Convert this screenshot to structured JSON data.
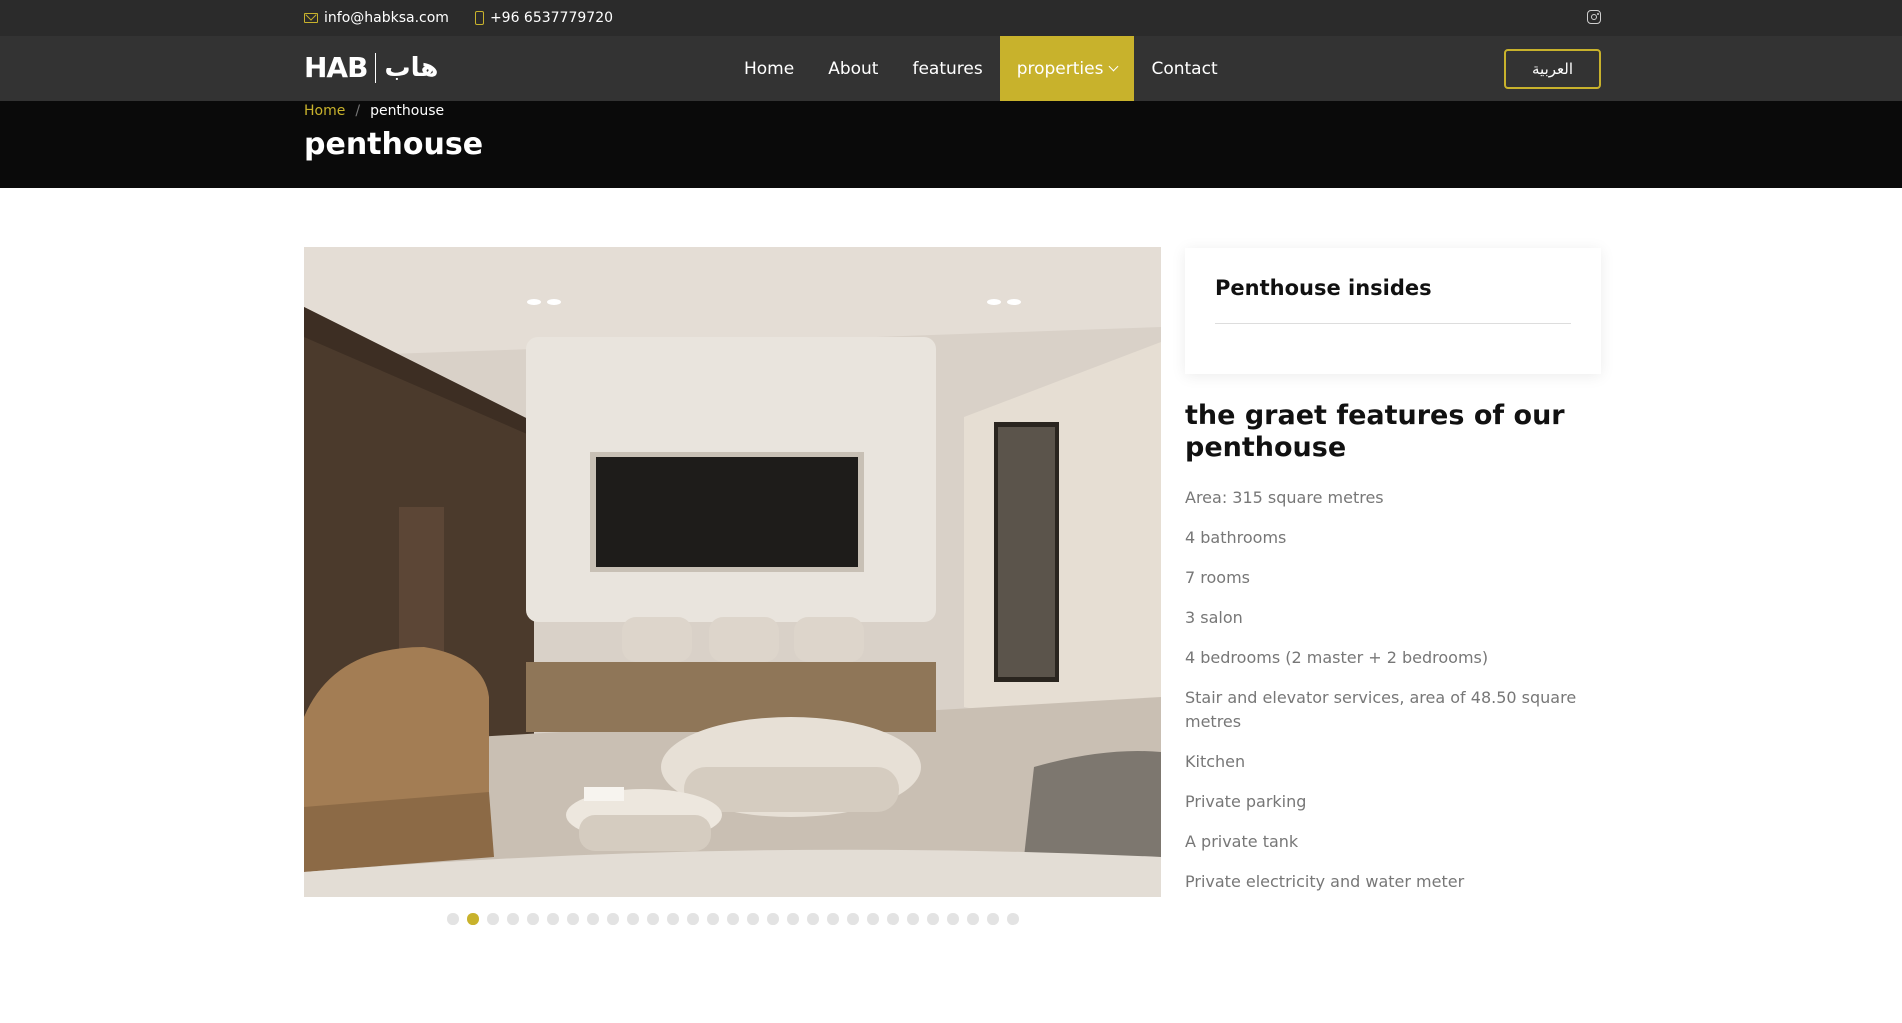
{
  "topbar": {
    "email": "info@habksa.com",
    "phone": "+96 6537779720",
    "icons": [
      "mail-icon",
      "phone-icon",
      "instagram-icon"
    ]
  },
  "logo": {
    "latin": "HAB",
    "arabic": "هاب"
  },
  "nav": {
    "items": [
      {
        "label": "Home"
      },
      {
        "label": "About"
      },
      {
        "label": "features"
      },
      {
        "label": "properties",
        "active": true,
        "dropdown": true
      },
      {
        "label": "Contact"
      }
    ],
    "language_button": "العربية"
  },
  "breadcrumb": {
    "home": "Home",
    "separator": "/",
    "current": "penthouse"
  },
  "page_title": "penthouse",
  "gallery": {
    "slide_count": 29,
    "active_index": 1
  },
  "sidebar": {
    "card_title": "Penthouse insides",
    "features_title": "the graet features of our penthouse",
    "features": [
      "Area: 315 square metres",
      "4 bathrooms",
      "7 rooms",
      "3 salon",
      "4 bedrooms (2 master + 2 bedrooms)",
      "Stair and elevator services, area of 48.50 square metres",
      "Kitchen",
      "Private parking",
      "A private tank",
      "Private electricity and water meter"
    ]
  },
  "colors": {
    "accent": "#c8b22c",
    "topbar_bg": "#2b2b2b",
    "navbar_bg": "#333333",
    "header_bg": "#0a0a0a",
    "text_muted": "#777777"
  }
}
